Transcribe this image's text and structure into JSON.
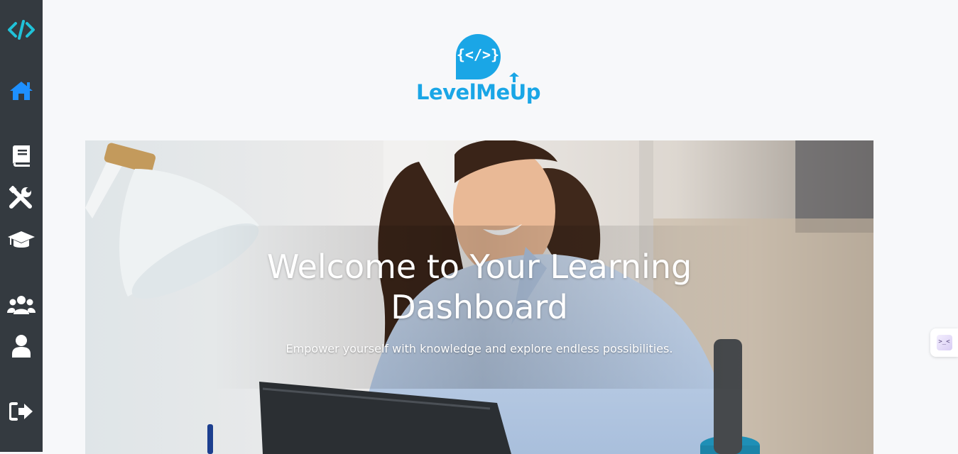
{
  "sidebar": {
    "items": [
      {
        "name": "code-icon",
        "label": "Home Logo"
      },
      {
        "name": "home-icon"
      },
      {
        "name": "book-icon"
      },
      {
        "name": "tools-icon"
      },
      {
        "name": "graduation-cap-icon"
      },
      {
        "name": "users-icon"
      },
      {
        "name": "user-icon"
      },
      {
        "name": "sign-out-icon"
      }
    ],
    "active_color": "#1e90ff",
    "icon_color": "#ffffff",
    "accent_color": "#20c2d9"
  },
  "brand": {
    "logo_symbol": "{</>}",
    "name": "LevelMeUp",
    "color": "#1aa6e6"
  },
  "hero": {
    "title_line1": "Welcome to Your Learning",
    "title_line2": "Dashboard",
    "subtitle": "Empower yourself with knowledge and explore endless possibilities."
  },
  "floating_widget": {
    "icon": "assistant-icon",
    "glyph": ">_<"
  }
}
